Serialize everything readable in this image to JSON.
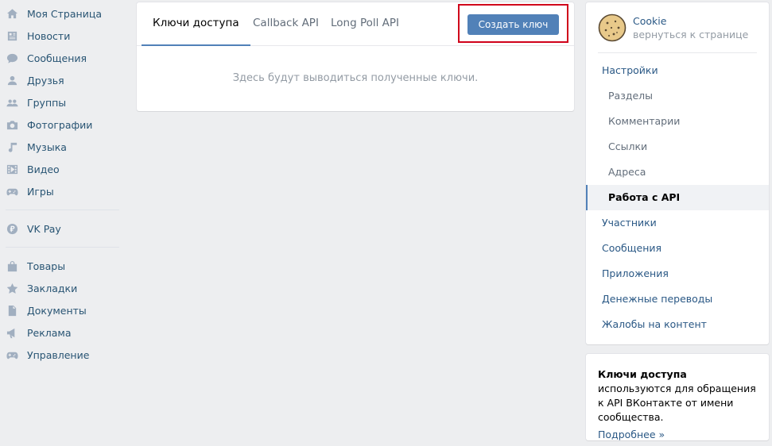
{
  "left_nav": {
    "group1": [
      {
        "label": "Моя Страница",
        "icon": "home-icon"
      },
      {
        "label": "Новости",
        "icon": "news-icon"
      },
      {
        "label": "Сообщения",
        "icon": "messages-icon"
      },
      {
        "label": "Друзья",
        "icon": "friends-icon"
      },
      {
        "label": "Группы",
        "icon": "groups-icon"
      },
      {
        "label": "Фотографии",
        "icon": "photos-icon"
      },
      {
        "label": "Музыка",
        "icon": "music-icon"
      },
      {
        "label": "Видео",
        "icon": "video-icon"
      },
      {
        "label": "Игры",
        "icon": "games-icon"
      }
    ],
    "group2": [
      {
        "label": "VK Pay",
        "icon": "vkpay-icon"
      }
    ],
    "group3": [
      {
        "label": "Товары",
        "icon": "goods-icon"
      },
      {
        "label": "Закладки",
        "icon": "bookmarks-icon"
      },
      {
        "label": "Документы",
        "icon": "documents-icon"
      },
      {
        "label": "Реклама",
        "icon": "ads-icon"
      },
      {
        "label": "Управление",
        "icon": "manage-icon"
      }
    ]
  },
  "main": {
    "tabs": [
      {
        "label": "Ключи доступа",
        "active": true
      },
      {
        "label": "Callback API",
        "active": false
      },
      {
        "label": "Long Poll API",
        "active": false
      }
    ],
    "create_button": "Создать ключ",
    "empty_message": "Здесь будут выводиться полученные ключи."
  },
  "right_menu": {
    "profile_name": "Cookie",
    "profile_back": "вернуться к странице",
    "items": [
      {
        "label": "Настройки",
        "level": "top"
      },
      {
        "label": "Разделы",
        "level": "sub"
      },
      {
        "label": "Комментарии",
        "level": "sub"
      },
      {
        "label": "Ссылки",
        "level": "sub"
      },
      {
        "label": "Адреса",
        "level": "sub"
      },
      {
        "label": "Работа с API",
        "level": "sub",
        "selected": true
      },
      {
        "label": "Участники",
        "level": "top"
      },
      {
        "label": "Сообщения",
        "level": "top"
      },
      {
        "label": "Приложения",
        "level": "top"
      },
      {
        "label": "Денежные переводы",
        "level": "top"
      },
      {
        "label": "Жалобы на контент",
        "level": "top"
      }
    ]
  },
  "info": {
    "bold": "Ключи доступа",
    "text": " используются для обращения к API ВКонтакте от имени сообщества.",
    "more": "Подробнее »"
  },
  "colors": {
    "accent": "#5181b8",
    "link": "#2a5885",
    "highlight_border": "#d0021b",
    "background": "#edeef0"
  }
}
